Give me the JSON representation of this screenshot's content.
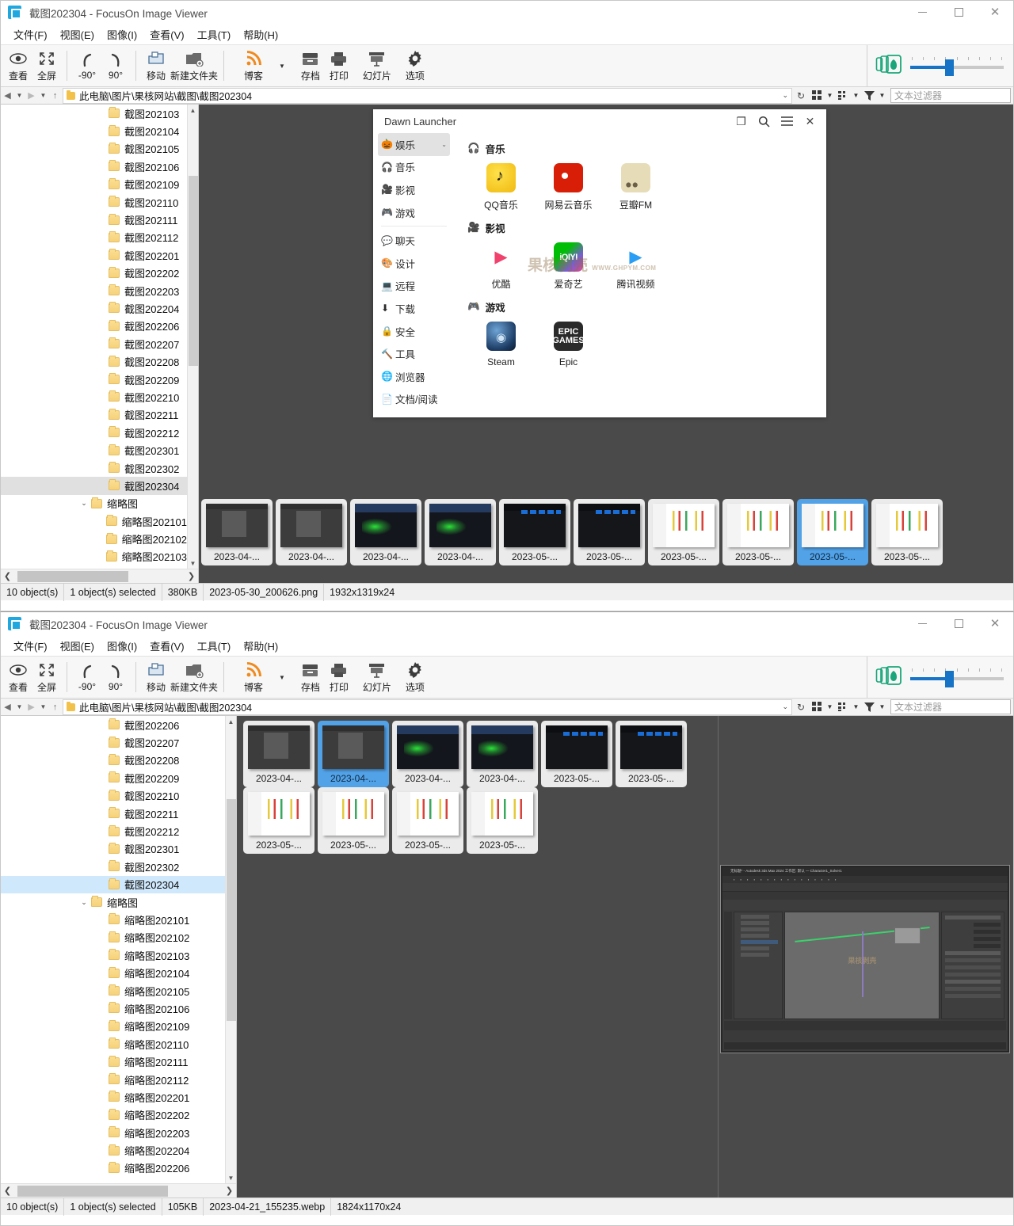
{
  "window1": {
    "title": "截图202304 - FocusOn Image Viewer",
    "controls": {
      "minimize": "–",
      "maximize": "□",
      "close": "✕"
    },
    "menu": [
      "文件(F)",
      "视图(E)",
      "图像(I)",
      "查看(V)",
      "工具(T)",
      "帮助(H)"
    ],
    "toolbar": {
      "buttons": [
        {
          "label": "查看",
          "icon": "eye-icon"
        },
        {
          "label": "全屏",
          "icon": "fullscreen-icon"
        },
        {
          "label": "-90°",
          "icon": "rotate-left-icon"
        },
        {
          "label": "90°",
          "icon": "rotate-right-icon"
        },
        {
          "label": "移动",
          "icon": "move-icon"
        },
        {
          "label": "新建文件夹",
          "icon": "new-folder-icon"
        },
        {
          "label": "博客",
          "icon": "rss-icon"
        },
        {
          "label": "存档",
          "icon": "archive-icon"
        },
        {
          "label": "打印",
          "icon": "print-icon"
        },
        {
          "label": "幻灯片",
          "icon": "slideshow-icon"
        },
        {
          "label": "选项",
          "icon": "gear-icon"
        }
      ],
      "zoom_percent": 40
    },
    "address": {
      "path": "此电脑\\图片\\果核网站\\截图\\截图202304",
      "filter_placeholder": "文本过滤器"
    },
    "tree": [
      {
        "label": "截图202103",
        "indent": 2,
        "state": "normal"
      },
      {
        "label": "截图202104",
        "indent": 2,
        "state": "normal"
      },
      {
        "label": "截图202105",
        "indent": 2,
        "state": "normal"
      },
      {
        "label": "截图202106",
        "indent": 2,
        "state": "normal"
      },
      {
        "label": "截图202109",
        "indent": 2,
        "state": "normal"
      },
      {
        "label": "截图202110",
        "indent": 2,
        "state": "normal"
      },
      {
        "label": "截图202111",
        "indent": 2,
        "state": "normal"
      },
      {
        "label": "截图202112",
        "indent": 2,
        "state": "normal"
      },
      {
        "label": "截图202201",
        "indent": 2,
        "state": "normal"
      },
      {
        "label": "截图202202",
        "indent": 2,
        "state": "normal"
      },
      {
        "label": "截图202203",
        "indent": 2,
        "state": "normal"
      },
      {
        "label": "截图202204",
        "indent": 2,
        "state": "normal"
      },
      {
        "label": "截图202206",
        "indent": 2,
        "state": "normal"
      },
      {
        "label": "截图202207",
        "indent": 2,
        "state": "normal"
      },
      {
        "label": "截图202208",
        "indent": 2,
        "state": "normal"
      },
      {
        "label": "截图202209",
        "indent": 2,
        "state": "normal"
      },
      {
        "label": "截图202210",
        "indent": 2,
        "state": "normal"
      },
      {
        "label": "截图202211",
        "indent": 2,
        "state": "normal"
      },
      {
        "label": "截图202212",
        "indent": 2,
        "state": "normal"
      },
      {
        "label": "截图202301",
        "indent": 2,
        "state": "normal"
      },
      {
        "label": "截图202302",
        "indent": 2,
        "state": "normal"
      },
      {
        "label": "截图202304",
        "indent": 2,
        "state": "selected-gray"
      },
      {
        "label": "缩略图",
        "indent": 1,
        "state": "expanded"
      },
      {
        "label": "缩略图202101",
        "indent": 2,
        "state": "normal"
      },
      {
        "label": "缩略图202102",
        "indent": 2,
        "state": "normal"
      },
      {
        "label": "缩略图202103",
        "indent": 2,
        "state": "normal"
      }
    ],
    "dawn_launcher": {
      "title": "Dawn Launcher",
      "controls": [
        "window-icon",
        "search-icon",
        "menu-icon",
        "close-icon"
      ],
      "categories": [
        {
          "label": "娱乐",
          "icon": "pumpkin-icon",
          "active": true,
          "caret": "⌄"
        },
        {
          "label": "音乐",
          "icon": "headphones-icon",
          "active": false
        },
        {
          "label": "影视",
          "icon": "film-icon",
          "active": false
        },
        {
          "label": "游戏",
          "icon": "gamepad-icon",
          "active": false
        },
        {
          "label": "聊天",
          "icon": "chat-icon",
          "active": false
        },
        {
          "label": "设计",
          "icon": "palette-icon",
          "active": false
        },
        {
          "label": "远程",
          "icon": "laptop-icon",
          "active": false
        },
        {
          "label": "下载",
          "icon": "download-icon",
          "active": false
        },
        {
          "label": "安全",
          "icon": "lock-icon",
          "active": false
        },
        {
          "label": "工具",
          "icon": "hammer-icon",
          "active": false
        },
        {
          "label": "浏览器",
          "icon": "globe-icon",
          "active": false
        },
        {
          "label": "文档/阅读",
          "icon": "document-icon",
          "active": false
        }
      ],
      "groups": [
        {
          "title": "音乐",
          "icon": "headphones-icon",
          "items": [
            {
              "name": "QQ音乐",
              "icon": "qq-music-icon"
            },
            {
              "name": "网易云音乐",
              "icon": "netease-music-icon"
            },
            {
              "name": "豆瓣FM",
              "icon": "douban-fm-icon"
            }
          ]
        },
        {
          "title": "影视",
          "icon": "film-icon",
          "items": [
            {
              "name": "优酷",
              "icon": "youku-icon"
            },
            {
              "name": "爱奇艺",
              "icon": "iqiyi-icon",
              "badge": "iQIYI"
            },
            {
              "name": "腾讯视频",
              "icon": "tencent-video-icon"
            }
          ]
        },
        {
          "title": "游戏",
          "icon": "gamepad-icon",
          "items": [
            {
              "name": "Steam",
              "icon": "steam-icon"
            },
            {
              "name": "Epic",
              "icon": "epic-games-icon",
              "badge": "EPIC GAMES"
            }
          ]
        }
      ],
      "watermark": "果核剥壳",
      "watermark_sub": "WWW.GHPYM.COM"
    },
    "thumbnails": [
      {
        "caption": "2023-04-...",
        "kind": "max",
        "selected": false
      },
      {
        "caption": "2023-04-...",
        "kind": "max",
        "selected": false
      },
      {
        "caption": "2023-04-...",
        "kind": "cad",
        "selected": false
      },
      {
        "caption": "2023-04-...",
        "kind": "cad",
        "selected": false
      },
      {
        "caption": "2023-05-...",
        "kind": "dark",
        "selected": false
      },
      {
        "caption": "2023-05-...",
        "kind": "dark",
        "selected": false
      },
      {
        "caption": "2023-05-...",
        "kind": "light",
        "selected": false
      },
      {
        "caption": "2023-05-...",
        "kind": "light",
        "selected": false
      },
      {
        "caption": "2023-05-...",
        "kind": "light",
        "selected": true
      },
      {
        "caption": "2023-05-...",
        "kind": "light",
        "selected": false
      }
    ],
    "status": {
      "objects": "10 object(s)",
      "selected": "1 object(s) selected",
      "size": "380KB",
      "filename": "2023-05-30_200626.png",
      "dimensions": "1932x1319x24"
    }
  },
  "window2": {
    "title": "截图202304 - FocusOn Image Viewer",
    "controls": {
      "minimize": "–",
      "maximize": "□",
      "close": "✕"
    },
    "menu": [
      "文件(F)",
      "视图(E)",
      "图像(I)",
      "查看(V)",
      "工具(T)",
      "帮助(H)"
    ],
    "toolbar": {
      "buttons": [
        {
          "label": "查看",
          "icon": "eye-icon"
        },
        {
          "label": "全屏",
          "icon": "fullscreen-icon"
        },
        {
          "label": "-90°",
          "icon": "rotate-left-icon"
        },
        {
          "label": "90°",
          "icon": "rotate-right-icon"
        },
        {
          "label": "移动",
          "icon": "move-icon"
        },
        {
          "label": "新建文件夹",
          "icon": "new-folder-icon"
        },
        {
          "label": "博客",
          "icon": "rss-icon"
        },
        {
          "label": "存档",
          "icon": "archive-icon"
        },
        {
          "label": "打印",
          "icon": "print-icon"
        },
        {
          "label": "幻灯片",
          "icon": "slideshow-icon"
        },
        {
          "label": "选项",
          "icon": "gear-icon"
        }
      ],
      "zoom_percent": 40
    },
    "address": {
      "path": "此电脑\\图片\\果核网站\\截图\\截图202304",
      "filter_placeholder": "文本过滤器"
    },
    "tree": [
      {
        "label": "截图202206",
        "indent": 2,
        "state": "normal"
      },
      {
        "label": "截图202207",
        "indent": 2,
        "state": "normal"
      },
      {
        "label": "截图202208",
        "indent": 2,
        "state": "normal"
      },
      {
        "label": "截图202209",
        "indent": 2,
        "state": "normal"
      },
      {
        "label": "截图202210",
        "indent": 2,
        "state": "normal"
      },
      {
        "label": "截图202211",
        "indent": 2,
        "state": "normal"
      },
      {
        "label": "截图202212",
        "indent": 2,
        "state": "normal"
      },
      {
        "label": "截图202301",
        "indent": 2,
        "state": "normal"
      },
      {
        "label": "截图202302",
        "indent": 2,
        "state": "normal"
      },
      {
        "label": "截图202304",
        "indent": 2,
        "state": "selected-blue"
      },
      {
        "label": "缩略图",
        "indent": 1,
        "state": "expanded"
      },
      {
        "label": "缩略图202101",
        "indent": 2,
        "state": "normal"
      },
      {
        "label": "缩略图202102",
        "indent": 2,
        "state": "normal"
      },
      {
        "label": "缩略图202103",
        "indent": 2,
        "state": "normal"
      },
      {
        "label": "缩略图202104",
        "indent": 2,
        "state": "normal"
      },
      {
        "label": "缩略图202105",
        "indent": 2,
        "state": "normal"
      },
      {
        "label": "缩略图202106",
        "indent": 2,
        "state": "normal"
      },
      {
        "label": "缩略图202109",
        "indent": 2,
        "state": "normal"
      },
      {
        "label": "缩略图202110",
        "indent": 2,
        "state": "normal"
      },
      {
        "label": "缩略图202111",
        "indent": 2,
        "state": "normal"
      },
      {
        "label": "缩略图202112",
        "indent": 2,
        "state": "normal"
      },
      {
        "label": "缩略图202201",
        "indent": 2,
        "state": "normal"
      },
      {
        "label": "缩略图202202",
        "indent": 2,
        "state": "normal"
      },
      {
        "label": "缩略图202203",
        "indent": 2,
        "state": "normal"
      },
      {
        "label": "缩略图202204",
        "indent": 2,
        "state": "normal"
      },
      {
        "label": "缩略图202206",
        "indent": 2,
        "state": "normal"
      }
    ],
    "thumbnails": [
      {
        "caption": "2023-04-...",
        "kind": "max",
        "selected": false
      },
      {
        "caption": "2023-04-...",
        "kind": "max",
        "selected": true
      },
      {
        "caption": "2023-04-...",
        "kind": "cad",
        "selected": false
      },
      {
        "caption": "2023-04-...",
        "kind": "cad",
        "selected": false
      },
      {
        "caption": "2023-05-...",
        "kind": "dark",
        "selected": false
      },
      {
        "caption": "2023-05-...",
        "kind": "dark",
        "selected": false
      },
      {
        "caption": "2023-05-...",
        "kind": "light",
        "selected": false
      },
      {
        "caption": "2023-05-...",
        "kind": "light",
        "selected": false
      },
      {
        "caption": "2023-05-...",
        "kind": "light",
        "selected": false
      },
      {
        "caption": "2023-05-...",
        "kind": "light",
        "selected": false
      }
    ],
    "preview": {
      "app_title": "无标题* - Autodesk 3ds Max 2024 工作区: 默认 — Character1_Solver1",
      "watermark": "果核剥壳"
    },
    "status": {
      "objects": "10 object(s)",
      "selected": "1 object(s) selected",
      "size": "105KB",
      "filename": "2023-04-21_155235.webp",
      "dimensions": "1824x1170x24"
    }
  }
}
